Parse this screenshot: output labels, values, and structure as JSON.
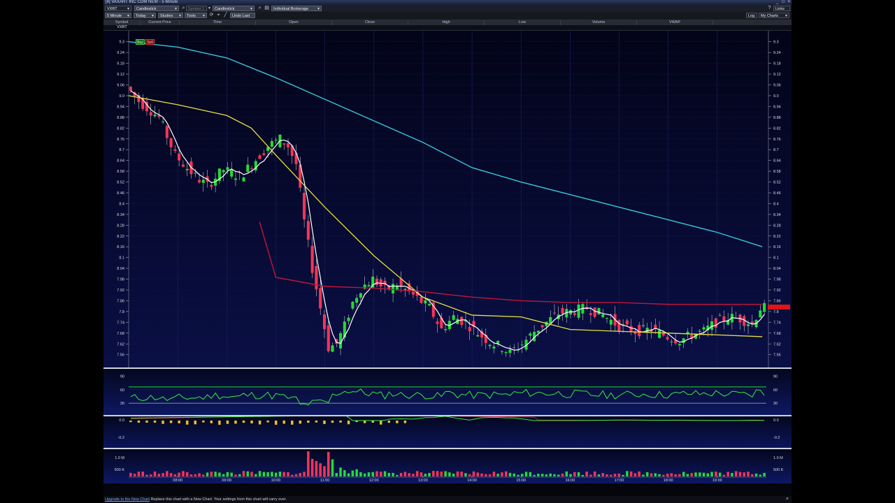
{
  "window": {
    "title": "[8] VAXART INC COM NEW - 5 Minute",
    "controls": [
      "_",
      "□",
      "×"
    ]
  },
  "toolbar1": {
    "symbol": "VXRT",
    "chart_style": "Candlestick",
    "symbol2_placeholder": "Symbol 2",
    "chart_style2": "Candlestick",
    "account": "Individual Brokerage",
    "links": "Links"
  },
  "toolbar2": {
    "interval": "5 Minute",
    "range": "Today",
    "studies": "Studies",
    "tools": "Tools",
    "undo": "Undo Last",
    "log": "Log",
    "my_charts": "My Charts"
  },
  "quote": {
    "headers": [
      "Symbol",
      "Current Price",
      "Time",
      "Open",
      "Close",
      "High",
      "Low",
      "Volume",
      "VWAP"
    ],
    "values": [
      "VXRT",
      "",
      "",
      "",
      "",
      "",
      "",
      "",
      ""
    ]
  },
  "buttons": {
    "buy": "Buy",
    "sell": "Sell"
  },
  "price_axis": {
    "labels": [
      "9.3",
      "9.24",
      "9.18",
      "9.12",
      "9.06",
      "9.0",
      "8.94",
      "8.88",
      "8.82",
      "8.76",
      "8.7",
      "8.64",
      "8.58",
      "8.52",
      "8.46",
      "8.4",
      "8.34",
      "8.28",
      "8.22",
      "8.16",
      "8.1",
      "8.04",
      "7.98",
      "7.92",
      "7.86",
      "7.8",
      "7.74",
      "7.68",
      "7.62",
      "7.56"
    ],
    "min": 7.56,
    "max": 9.3
  },
  "time_axis": {
    "labels": [
      "08:00",
      "09:00",
      "10:00",
      "11:00",
      "12:00",
      "13:00",
      "14:00",
      "15:00",
      "16:00",
      "17:00",
      "18:00",
      "19:00"
    ]
  },
  "rsi": {
    "labels": [
      "90",
      "60",
      "30"
    ]
  },
  "macd": {
    "labels": [
      "0.0",
      "-0.2"
    ]
  },
  "volume": {
    "labels": [
      "1.0 M",
      "500 K"
    ]
  },
  "colors": {
    "up": "#22dd33",
    "down": "#ff3355",
    "white_ma": "#ffffff",
    "yellow_ma": "#e8e040",
    "cyan_ma": "#33c8d8",
    "red_ma": "#c0153a",
    "last_price": "#e01616"
  },
  "chart_data": {
    "type": "candlestick",
    "x_range": [
      "07:00",
      "20:00"
    ],
    "y_range": [
      7.52,
      9.33
    ],
    "overlays": {
      "cyan_ma_path": [
        [
          "07:00",
          9.3
        ],
        [
          "08:00",
          9.27
        ],
        [
          "09:00",
          9.21
        ],
        [
          "10:00",
          9.1
        ],
        [
          "11:00",
          8.98
        ],
        [
          "12:00",
          8.86
        ],
        [
          "13:00",
          8.74
        ],
        [
          "14:00",
          8.6
        ],
        [
          "15:00",
          8.52
        ],
        [
          "16:00",
          8.45
        ],
        [
          "17:00",
          8.38
        ],
        [
          "18:00",
          8.31
        ],
        [
          "19:00",
          8.24
        ],
        [
          "19:55",
          8.16
        ]
      ],
      "yellow_ma_path": [
        [
          "07:00",
          9.0
        ],
        [
          "08:00",
          8.95
        ],
        [
          "09:00",
          8.89
        ],
        [
          "09:30",
          8.82
        ],
        [
          "10:00",
          8.67
        ],
        [
          "11:00",
          8.38
        ],
        [
          "12:00",
          8.11
        ],
        [
          "13:00",
          7.88
        ],
        [
          "14:00",
          7.78
        ],
        [
          "15:00",
          7.77
        ],
        [
          "16:00",
          7.7
        ],
        [
          "17:00",
          7.69
        ],
        [
          "18:00",
          7.68
        ],
        [
          "19:00",
          7.67
        ],
        [
          "19:55",
          7.66
        ]
      ],
      "red_ma_path": [
        [
          "09:40",
          8.3
        ],
        [
          "10:00",
          7.99
        ],
        [
          "11:00",
          7.94
        ],
        [
          "12:00",
          7.93
        ],
        [
          "13:00",
          7.91
        ],
        [
          "14:00",
          7.88
        ],
        [
          "15:00",
          7.86
        ],
        [
          "16:00",
          7.85
        ],
        [
          "17:00",
          7.85
        ],
        [
          "18:00",
          7.84
        ],
        [
          "19:55",
          7.84
        ]
      ]
    },
    "candles_summary": {
      "open": 9.05,
      "high": 9.05,
      "low": 7.54,
      "last": 7.82
    },
    "rsi_levels": [
      30,
      60,
      90
    ],
    "volume_max_label": "1.0 M"
  }
}
